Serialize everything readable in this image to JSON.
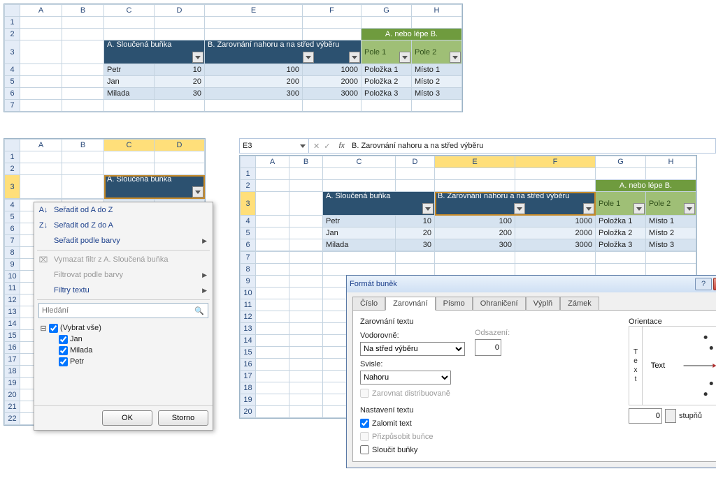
{
  "top": {
    "cols": [
      "A",
      "B",
      "C",
      "D",
      "E",
      "F",
      "G",
      "H"
    ],
    "rows": [
      "1",
      "2",
      "3",
      "4",
      "5",
      "6",
      "7"
    ],
    "hdrA": "A. Sloučená buňka",
    "hdrB": "B. Zarovnání nahoru a na střed výběru",
    "hdrAB": "A. nebo lépe B.",
    "pole1": "Pole 1",
    "pole2": "Pole 2",
    "data": [
      {
        "c": "Petr",
        "d": "10",
        "e": "100",
        "f": "1000",
        "g": "Položka 1",
        "h": "Místo 1"
      },
      {
        "c": "Jan",
        "d": "20",
        "e": "200",
        "f": "2000",
        "g": "Položka 2",
        "h": "Místo 2"
      },
      {
        "c": "Milada",
        "d": "30",
        "e": "300",
        "f": "3000",
        "g": "Položka 3",
        "h": "Místo 3"
      }
    ]
  },
  "left": {
    "cols": [
      "A",
      "B",
      "C",
      "D"
    ],
    "rows": [
      "1",
      "2",
      "3",
      "4",
      "5",
      "6",
      "7",
      "8",
      "9",
      "10",
      "11",
      "12",
      "13",
      "14",
      "15",
      "16",
      "17",
      "18",
      "19",
      "20",
      "21",
      "22"
    ],
    "hdrA": "A. Sloučená buňka"
  },
  "menu": {
    "sort_az": "Seřadit od A do Z",
    "sort_za": "Seřadit od Z do A",
    "sort_color": "Seřadit podle barvy",
    "clear": "Vymazat filtr z A. Sloučená buňka",
    "filter_color": "Filtrovat podle barvy",
    "text_filter": "Filtry textu",
    "search_ph": "Hledání",
    "items": [
      {
        "label": "(Vybrat vše)",
        "exp": "⊟",
        "chk": true
      },
      {
        "label": "Jan",
        "chk": true
      },
      {
        "label": "Milada",
        "chk": true
      },
      {
        "label": "Petr",
        "chk": true
      }
    ],
    "ok": "OK",
    "cancel": "Storno"
  },
  "fb": {
    "cell": "E3",
    "val": "B. Zarovnání nahoru a na střed výběru"
  },
  "right": {
    "cols": [
      "A",
      "B",
      "C",
      "D",
      "E",
      "F",
      "G",
      "H"
    ],
    "rows": [
      "1",
      "2",
      "3",
      "4",
      "5",
      "6",
      "7",
      "8",
      "9",
      "10",
      "11",
      "12",
      "13",
      "14",
      "15",
      "16",
      "17",
      "18",
      "19",
      "20"
    ],
    "hdrA": "A. Sloučená buňka",
    "hdrB": "B. Zarovnání nahoru a na střed výběru",
    "hdrAB": "A. nebo lépe B.",
    "pole1": "Pole 1",
    "pole2": "Pole 2",
    "data": [
      {
        "c": "Petr",
        "d": "10",
        "e": "100",
        "f": "1000",
        "g": "Položka 1",
        "h": "Místo 1"
      },
      {
        "c": "Jan",
        "d": "20",
        "e": "200",
        "f": "2000",
        "g": "Položka 2",
        "h": "Místo 2"
      },
      {
        "c": "Milada",
        "d": "30",
        "e": "300",
        "f": "3000",
        "g": "Položka 3",
        "h": "Místo 3"
      }
    ]
  },
  "dlg": {
    "title": "Formát buněk",
    "tabs": [
      "Číslo",
      "Zarovnání",
      "Písmo",
      "Ohraničení",
      "Výplň",
      "Zámek"
    ],
    "grp_align": "Zarovnání textu",
    "lb_horz": "Vodorovně:",
    "val_horz": "Na střed výběru",
    "lb_indent": "Odsazení:",
    "val_indent": "0",
    "lb_vert": "Svisle:",
    "val_vert": "Nahoru",
    "chk_dist": "Zarovnat distribuovaně",
    "grp_text": "Nastavení textu",
    "chk_wrap": "Zalomit text",
    "chk_fit": "Přizpůsobit buňce",
    "chk_merge": "Sloučit buňky",
    "grp_orient": "Orientace",
    "orient_txt": "Text",
    "orient_v": "Text",
    "orient_unit": "stupňů",
    "orient_val": "0"
  }
}
